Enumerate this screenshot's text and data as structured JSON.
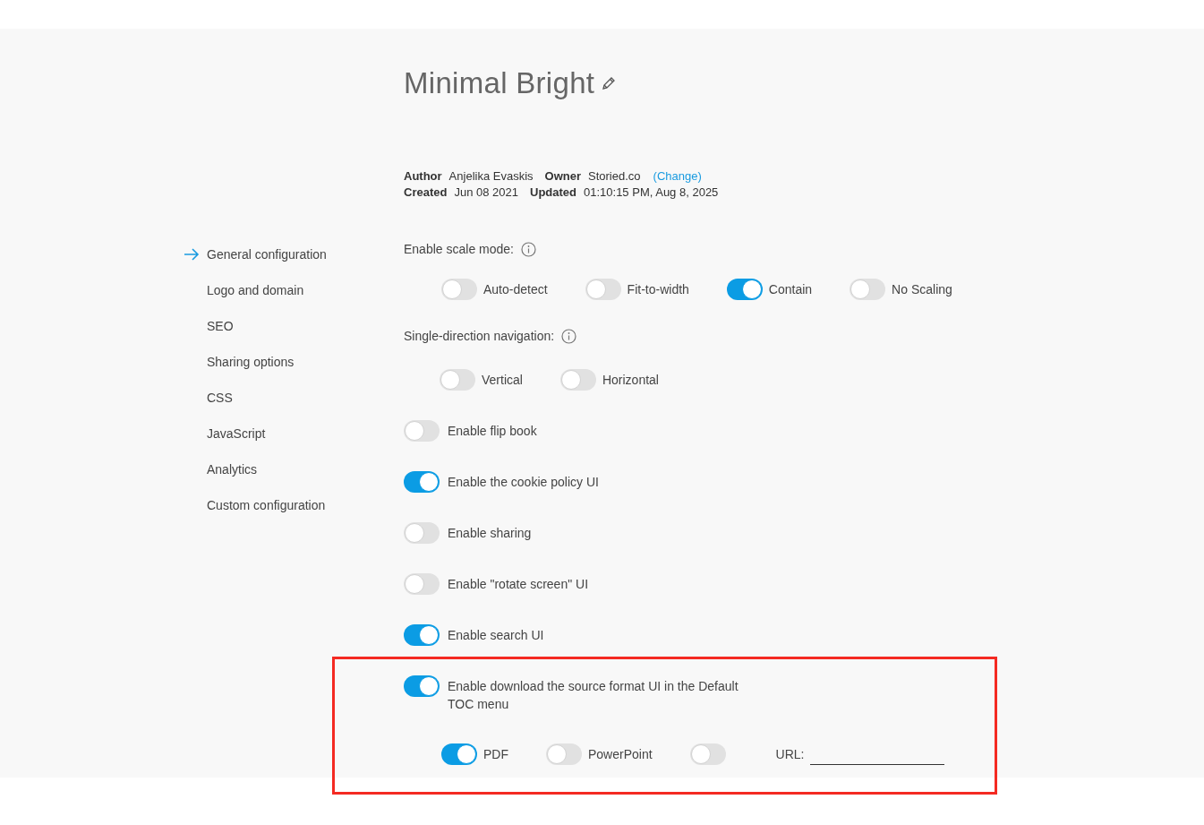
{
  "settings_nav": {
    "items": [
      {
        "label": "General configuration",
        "selected": true
      },
      {
        "label": "Logo and domain",
        "selected": false
      },
      {
        "label": "SEO",
        "selected": false
      },
      {
        "label": "Sharing options",
        "selected": false
      },
      {
        "label": "CSS",
        "selected": false
      },
      {
        "label": "JavaScript",
        "selected": false
      },
      {
        "label": "Analytics",
        "selected": false
      },
      {
        "label": "Custom configuration",
        "selected": false
      }
    ]
  },
  "presentation": {
    "title": "Minimal Bright",
    "meta": [
      [
        {
          "label": "Author",
          "value": "Anjelika Evaskis"
        },
        {
          "label": "Owner",
          "value": "Storied.co",
          "link": "(Change)"
        }
      ],
      [
        {
          "label": "Created",
          "value": "Jun 08 2021"
        },
        {
          "label": "Updated",
          "value": "01:10:15 PM, Aug 8, 2025"
        }
      ]
    ]
  },
  "scale_mode": {
    "label": "Enable scale mode:",
    "options": [
      {
        "label": "Auto-detect",
        "on": false
      },
      {
        "label": "Fit-to-width",
        "on": false
      },
      {
        "label": "Contain",
        "on": true
      },
      {
        "label": "No Scaling",
        "on": false
      }
    ]
  },
  "navigation_direction": {
    "label": "Single-direction navigation:",
    "options": [
      {
        "label": "Vertical",
        "on": false
      },
      {
        "label": "Horizontal",
        "on": false
      }
    ]
  },
  "toggles": [
    {
      "label": "Enable flip book",
      "on": false
    },
    {
      "label": "Enable the cookie policy UI",
      "on": true
    },
    {
      "label": "Enable sharing",
      "on": false
    },
    {
      "label": "Enable \"rotate screen\" UI",
      "on": false
    },
    {
      "label": "Enable search UI",
      "on": true
    },
    {
      "label": "Enable download the source format UI in the Default TOC menu",
      "on": true
    }
  ],
  "download_formats": {
    "options": [
      {
        "label": "PDF",
        "on": true
      },
      {
        "label": "PowerPoint",
        "on": false
      },
      {
        "on": false
      }
    ],
    "url_label": "URL:"
  }
}
